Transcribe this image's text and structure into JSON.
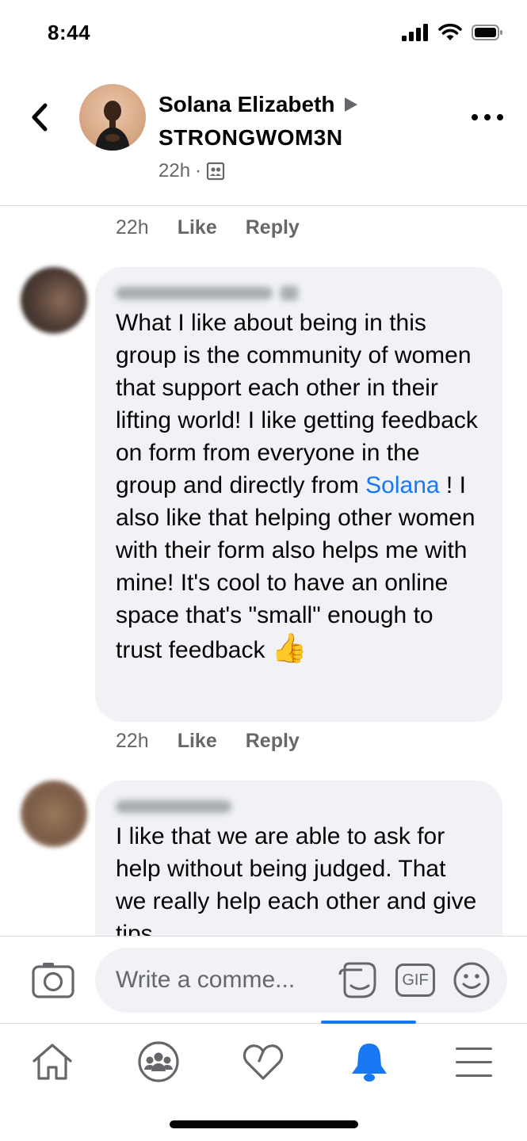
{
  "status_bar": {
    "time": "8:44"
  },
  "header": {
    "author_name": "Solana Elizabeth",
    "group_name": "STRONGWOM3N",
    "post_age": "22h",
    "separator": "·"
  },
  "feed": {
    "top_action_row": {
      "time": "22h",
      "like": "Like",
      "reply": "Reply"
    },
    "comments": [
      {
        "text_before_mention": "What I like about being in this group is the community of women that support each other in their lifting world! I like getting feedback on form from everyone in the group and directly from ",
        "mention": "Solana",
        "text_after_mention": " !  I also like that helping other women with their form also helps me with mine! It's cool to have an online space that's \"small\" enough to trust feedback",
        "emoji": "👍",
        "time": "22h",
        "like": "Like",
        "reply": "Reply"
      },
      {
        "text": "I like that we are able to ask for help without being judged. That we really help each other and give tips"
      }
    ]
  },
  "composer": {
    "placeholder": "Write a comme...",
    "gif_label": "GIF"
  },
  "colors": {
    "accent": "#1877f2",
    "bubble_bg": "#f0f2f5",
    "secondary_text": "#65676b"
  }
}
